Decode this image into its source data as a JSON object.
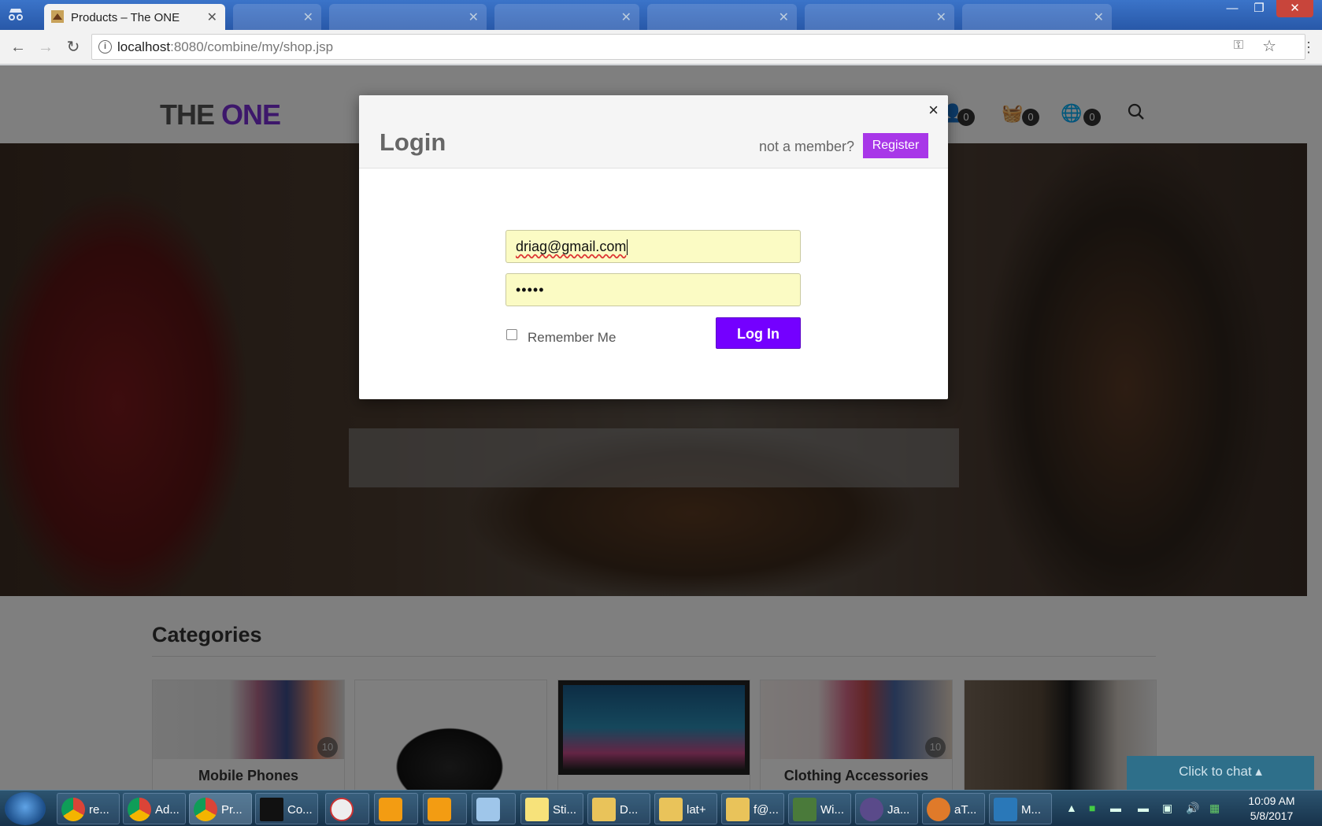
{
  "browser": {
    "active_tab_title": "Products – The ONE",
    "url_host": "localhost",
    "url_rest": ":8080/combine/my/shop.jsp"
  },
  "site": {
    "logo_part1": "THE ",
    "logo_part2": "ONE",
    "header_counts": [
      "0",
      "0",
      "0"
    ]
  },
  "categories": {
    "title": "Categories",
    "cards": [
      {
        "label": "Mobile Phones",
        "count": "10"
      },
      {
        "label": "",
        "count": ""
      },
      {
        "label": "",
        "count": ""
      },
      {
        "label": "Clothing Accessories",
        "count": "10"
      },
      {
        "label": "",
        "count": ""
      }
    ]
  },
  "login_modal": {
    "title": "Login",
    "close_glyph": "×",
    "not_member_text": "not a member?",
    "register_label": "Register",
    "email_value": "driag@gmail.com",
    "password_mask": "•••••",
    "remember_label": "Remember Me",
    "login_label": "Log In"
  },
  "chat": {
    "label": "Click to chat ▴"
  },
  "taskbar": {
    "tasks": [
      {
        "label": "re..."
      },
      {
        "label": "Ad..."
      },
      {
        "label": "Pr..."
      },
      {
        "label": "Co..."
      },
      {
        "label": ""
      },
      {
        "label": ""
      },
      {
        "label": ""
      },
      {
        "label": ""
      },
      {
        "label": "Sti..."
      },
      {
        "label": "D..."
      },
      {
        "label": "lat+"
      },
      {
        "label": "f@..."
      },
      {
        "label": "Wi..."
      },
      {
        "label": "Ja..."
      },
      {
        "label": "aT..."
      },
      {
        "label": "M..."
      }
    ],
    "time": "10:09 AM",
    "date": "5/8/2017"
  }
}
